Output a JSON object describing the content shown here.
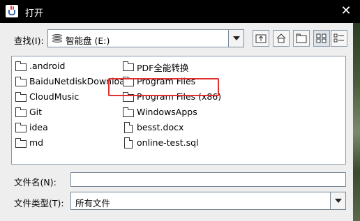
{
  "window": {
    "title": "打开",
    "close_glyph": "✕"
  },
  "lookin": {
    "label": "查找(I):",
    "drive_value": "智能盘 (E:)"
  },
  "toolbar": {
    "buttons": [
      "up-one-level-icon",
      "home-icon",
      "new-folder-icon",
      "list-view-icon",
      "details-view-icon"
    ]
  },
  "files": {
    "column1": [
      {
        "name": ".android",
        "type": "folder"
      },
      {
        "name": "BaiduNetdiskDownload",
        "type": "folder"
      },
      {
        "name": "CloudMusic",
        "type": "folder"
      },
      {
        "name": "Git",
        "type": "folder"
      },
      {
        "name": "idea",
        "type": "folder"
      },
      {
        "name": "md",
        "type": "folder"
      }
    ],
    "column2": [
      {
        "name": "PDF全能转换",
        "type": "folder"
      },
      {
        "name": "Program Files",
        "type": "folder"
      },
      {
        "name": "Program Files (x86)",
        "type": "folder"
      },
      {
        "name": "WindowsApps",
        "type": "folder"
      },
      {
        "name": "besst.docx",
        "type": "file"
      },
      {
        "name": "online-test.sql",
        "type": "file"
      }
    ],
    "highlighted": "online-test.sql",
    "highlight_color": "#e03030"
  },
  "filename": {
    "label": "文件名(N):",
    "value": ""
  },
  "filetype": {
    "label": "文件类型(T):",
    "value": "所有文件"
  }
}
